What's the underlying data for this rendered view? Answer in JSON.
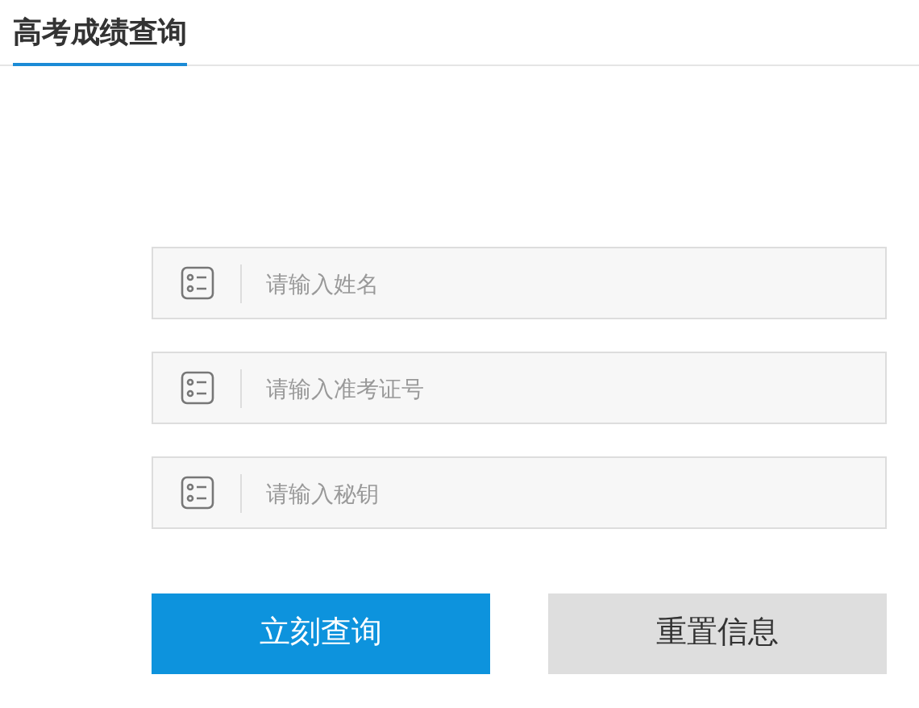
{
  "header": {
    "title": "高考成绩查询"
  },
  "fields": [
    {
      "placeholder": "请输入姓名"
    },
    {
      "placeholder": "请输入准考证号"
    },
    {
      "placeholder": "请输入秘钥"
    }
  ],
  "buttons": [
    {
      "label": "立刻查询",
      "kind": "primary"
    },
    {
      "label": "重置信息",
      "kind": "secondary"
    }
  ]
}
